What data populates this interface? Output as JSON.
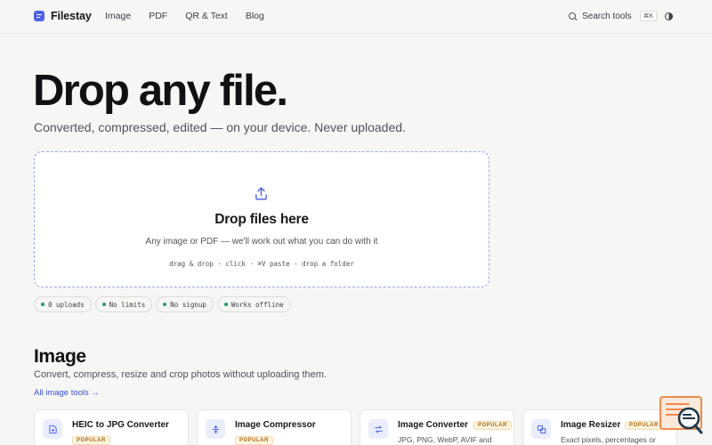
{
  "header": {
    "brand": "Filestay",
    "nav": [
      "Image",
      "PDF",
      "QR & Text",
      "Blog"
    ],
    "search_label": "Search tools",
    "search_shortcut": "⌘K"
  },
  "hero": {
    "title": "Drop any file.",
    "subtitle": "Converted, compressed, edited — on your device. Never uploaded."
  },
  "dropzone": {
    "title": "Drop files here",
    "description": "Any image or PDF — we'll work out what you can do with it",
    "hints": "drag & drop · click · ⌘V paste · drop a folder"
  },
  "pills": [
    "0 uploads",
    "No limits",
    "No signup",
    "Works offline"
  ],
  "section": {
    "title": "Image",
    "subtitle": "Convert, compress, resize and crop photos without uploading them.",
    "link": "All image tools →"
  },
  "cards": [
    {
      "title": "HEIC to JPG Converter",
      "badge": "POPULAR",
      "desc": ""
    },
    {
      "title": "Image Compressor",
      "badge": "POPULAR",
      "desc": ""
    },
    {
      "title": "Image Converter",
      "badge": "POPULAR",
      "desc": "JPG, PNG, WebP, AVIF and"
    },
    {
      "title": "Image Resizer",
      "badge": "POPULAR",
      "desc": "Exact pixels, percentages or"
    }
  ],
  "colors": {
    "accent": "#4f63e8",
    "background": "#f6f6f4",
    "dropzone_border": "#9aa4e8",
    "pill_dot": "#22a06b",
    "badge": "#a86a12"
  },
  "icons": {
    "brand": "file-logo-icon",
    "search": "search-icon",
    "theme": "contrast-icon",
    "upload": "upload-icon",
    "cards": [
      "file-plus-icon",
      "compress-icon",
      "convert-arrows-icon",
      "resize-icon"
    ],
    "help": "help-chat-icon"
  }
}
